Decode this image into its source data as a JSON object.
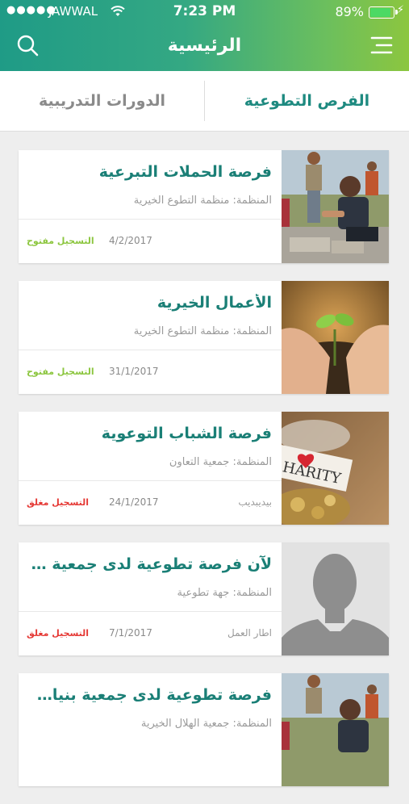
{
  "status_bar": {
    "signal": "●●●●●",
    "carrier": "JAWWAL",
    "time": "7:23 PM",
    "battery": "89%"
  },
  "header": {
    "title": "الرئيسية",
    "search_icon": "search-icon",
    "menu_icon": "menu-icon"
  },
  "tabs": {
    "left_label": "الدورات التدريبية",
    "right_label": "الفرص التطوعية",
    "active": "right"
  },
  "colors": {
    "accent": "#1a7f76",
    "open_status": "#8cc63f",
    "closed_status": "#e53935"
  },
  "cards": [
    {
      "title": "فرصة الحملات التبرعية",
      "org": "المنظمة: منظمة التطوع الخيرية",
      "date": "4/2/2017",
      "status": "التسجيل مفتوح",
      "extra": "",
      "image": "volunteers-construction-photo"
    },
    {
      "title": "الأعمال الخيرية",
      "org": "المنظمة: منظمة التطوع الخيرية",
      "date": "31/1/2017",
      "status": "التسجيل مفتوح",
      "extra": "",
      "image": "hands-seedling-photo"
    },
    {
      "title": "فرصة الشباب التوعوية",
      "org": "المنظمة: جمعية التعاون",
      "date": "24/1/2017",
      "status": "التسجيل مغلق",
      "extra": "بيديبديب",
      "image": "charity-jar-photo"
    },
    {
      "title": "لآن فرصة تطوعية لدى جمعية زهرة (...",
      "org": "المنظمة: جهة تطوعية",
      "date": "7/1/2017",
      "status": "التسجيل مغلق",
      "extra": "اطار العمل",
      "image": "avatar-placeholder"
    },
    {
      "title": "فرصة تطوعية لدى جمعية بنيان (من...",
      "org": "المنظمة: جمعية الهلال الخيرية",
      "date": "",
      "status": "",
      "extra": "",
      "image": "volunteers-construction-photo"
    }
  ]
}
